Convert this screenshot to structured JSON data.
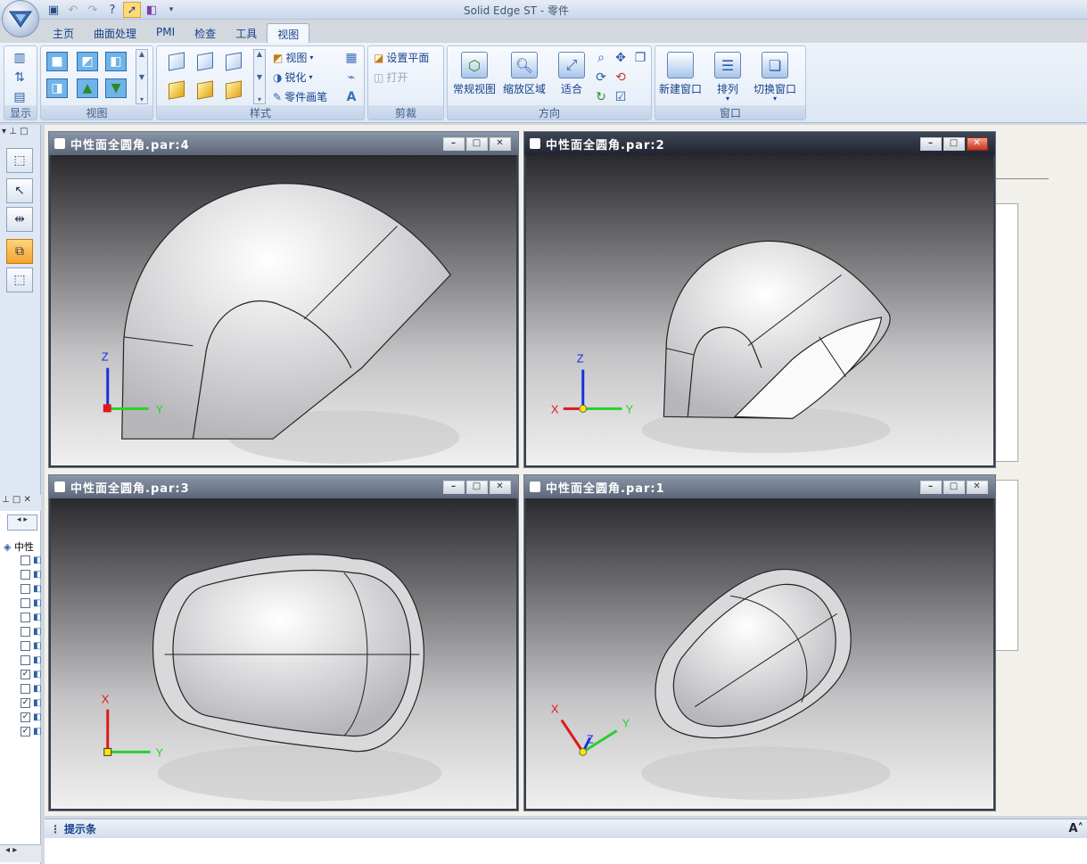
{
  "app": {
    "title": "Solid Edge ST - 零件"
  },
  "ribbon": {
    "tabs": [
      "主页",
      "曲面处理",
      "PMI",
      "检查",
      "工具",
      "视图"
    ],
    "active_tab": "视图",
    "groups": {
      "show": "显示",
      "views": "视图",
      "style": "样式",
      "clip": "剪裁",
      "orient": "方向",
      "window": "窗口"
    },
    "style_items": {
      "view": "视图",
      "sharpen": "锐化",
      "part_painter": "零件画笔"
    },
    "clip_items": {
      "set_plane": "设置平面",
      "open": "打开"
    },
    "orient_items": {
      "normal_view": "常规视图",
      "zoom_area": "缩放区域",
      "fit": "适合"
    },
    "window_items": {
      "new_window": "新建窗口",
      "arrange": "排列",
      "switch_window": "切换窗口"
    }
  },
  "windows": [
    {
      "title": "中性面全圆角.par:4",
      "active": false,
      "axes": [
        "Z",
        "Y"
      ]
    },
    {
      "title": "中性面全圆角.par:2",
      "active": true,
      "axes": [
        "Z",
        "X",
        "Y"
      ]
    },
    {
      "title": "中性面全圆角.par:3",
      "active": false,
      "axes": [
        "X",
        "Y"
      ]
    },
    {
      "title": "中性面全圆角.par:1",
      "active": false,
      "axes": [
        "X",
        "Z",
        "Y"
      ]
    }
  ],
  "window_buttons": {
    "minimize": "–",
    "maximize": "□",
    "close": "✕"
  },
  "pathfinder": {
    "root_label": "中性",
    "checkboxes": [
      false,
      false,
      false,
      false,
      false,
      false,
      false,
      false,
      true,
      false,
      true,
      true,
      true
    ]
  },
  "statusbar": {
    "label": "提示条",
    "font_btn": "A˄"
  },
  "colors": {
    "axis_x": "#e01818",
    "axis_y": "#28d12a",
    "axis_z": "#1a2ee0",
    "active_title": "#1f2430"
  }
}
